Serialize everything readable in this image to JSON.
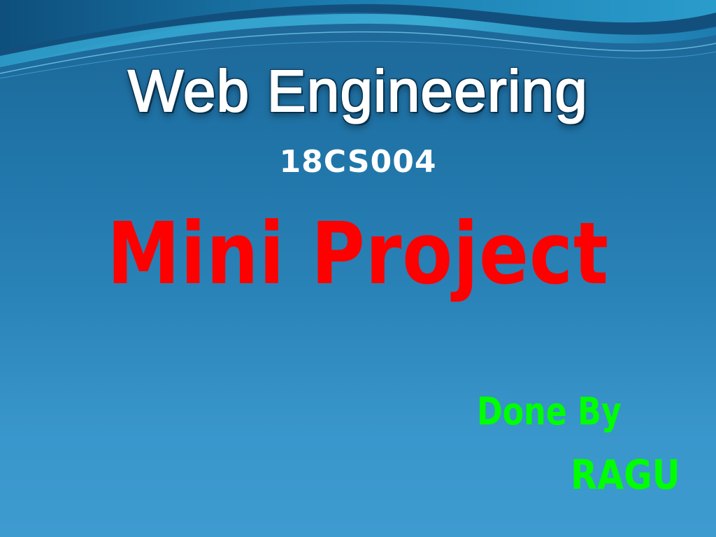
{
  "slide": {
    "title": "Web Engineering",
    "course_code": "18CS004",
    "headline": "Mini Project",
    "done_by_label": "Done By",
    "author": "RAGU"
  },
  "colors": {
    "background_top": "#1e6596",
    "background_bottom": "#3e9bd0",
    "title_text": "#ffffff",
    "headline_text": "#ff0000",
    "author_text": "#00ff00"
  }
}
